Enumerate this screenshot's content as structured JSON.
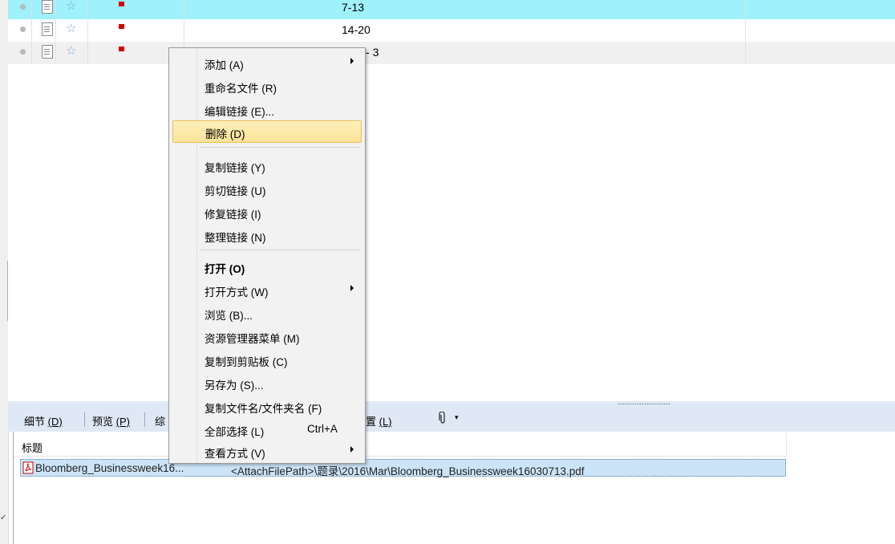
{
  "list": {
    "rows": [
      {
        "value": "7-13",
        "selected": true
      },
      {
        "value": "14-20",
        "selected": false
      },
      {
        "value": "3",
        "prefix_hidden": true,
        "selected": false
      }
    ]
  },
  "tabs": {
    "details": "细节 ",
    "details_key": "(D)",
    "preview": "预览 ",
    "preview_key": "(P)",
    "summary_partial": "综",
    "location_partial": "置 ",
    "location_key": "(L)"
  },
  "attachments": {
    "header": "标题",
    "items": [
      {
        "name": "Bloomberg_Businessweek16...",
        "path": "<AttachFilePath>\\题录\\2016\\Mar\\Bloomberg_Businessweek16030713.pdf"
      }
    ]
  },
  "context_menu": {
    "items": [
      {
        "label": "添加 (A)",
        "submenu": true
      },
      {
        "label": "重命名文件 (R)"
      },
      {
        "label": "编辑链接 (E)..."
      },
      {
        "label": "删除 (D)",
        "highlighted": true
      },
      {
        "label": "复制链接 (Y)"
      },
      {
        "label": "剪切链接 (U)"
      },
      {
        "label": "修复链接 (I)"
      },
      {
        "label": "整理链接 (N)"
      },
      {
        "label": "打开 (O)",
        "bold": true
      },
      {
        "label": "打开方式 (W)",
        "submenu": true
      },
      {
        "label": "浏览 (B)..."
      },
      {
        "label": "资源管理器菜单 (M)"
      },
      {
        "label": "复制到剪贴板 (C)"
      },
      {
        "label": "另存为 (S)..."
      },
      {
        "label": "复制文件名/文件夹名 (F)"
      },
      {
        "label": "全部选择 (L)",
        "accelerator": "Ctrl+A"
      },
      {
        "label": "查看方式 (V)",
        "submenu": true
      }
    ]
  },
  "colors": {
    "selected_row": "#9ff1fb",
    "alt_row": "#f0f0f0",
    "menu_highlight": "#fbe39a",
    "attach_selected": "#cce4f7",
    "flag": "#d40000"
  },
  "icons": [
    "status-dot-icon",
    "document-icon",
    "star-icon",
    "flag-icon",
    "paperclip-icon",
    "pdf-icon",
    "submenu-arrow-icon"
  ]
}
